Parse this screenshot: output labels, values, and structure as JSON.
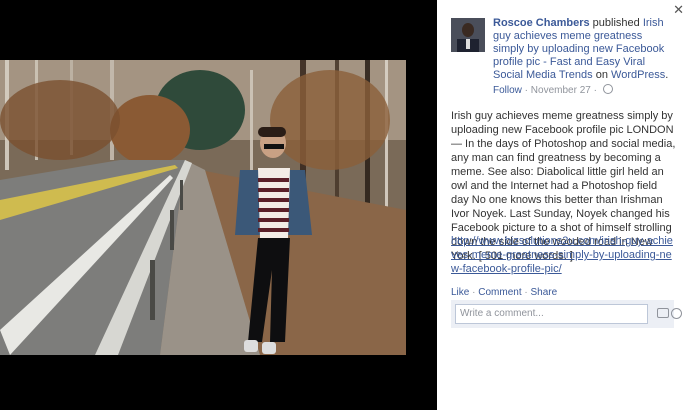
{
  "post": {
    "author": "Roscoe Chambers",
    "action_text": " published ",
    "article_title": "Irish guy achieves meme greatness simply by uploading new Facebook profile pic - Fast and Easy Viral Social Media Trends",
    "on_text": " on ",
    "site": "WordPress",
    "site_suffix": ".",
    "follow": "Follow",
    "separator": " · ",
    "date": "November 27",
    "date_suffix": " · ",
    "body": "Irish guy achieves meme greatness simply by uploading new Facebook profile pic LONDON — In the days of Photoshop and social media, any man can find greatness by becoming a meme. See also: Diabolical little girl held an owl and the Internet had a Photoshop field day No one knows this better than Irishman Ivor Noyek. Last Sunday, Noyek changed his Facebook picture to a shot of himself strolling down the side of the wooded road in New York. [ 501 more words. ]",
    "url": "http://www.bizsolutions2u.com/irish-guy-achieves-meme-greatness-simply-by-uploading-new-facebook-profile-pic/"
  },
  "actions": {
    "like": "Like",
    "dot1": " · ",
    "comment": "Comment",
    "dot2": " · ",
    "share": "Share"
  },
  "comment": {
    "placeholder": "Write a comment..."
  },
  "close": "✕",
  "icons": {
    "close": "close-icon",
    "camera": "camera-icon",
    "emoji": "emoji-icon",
    "globe": "globe-icon"
  },
  "colors": {
    "link": "#3b5998",
    "muted": "#90949c"
  }
}
